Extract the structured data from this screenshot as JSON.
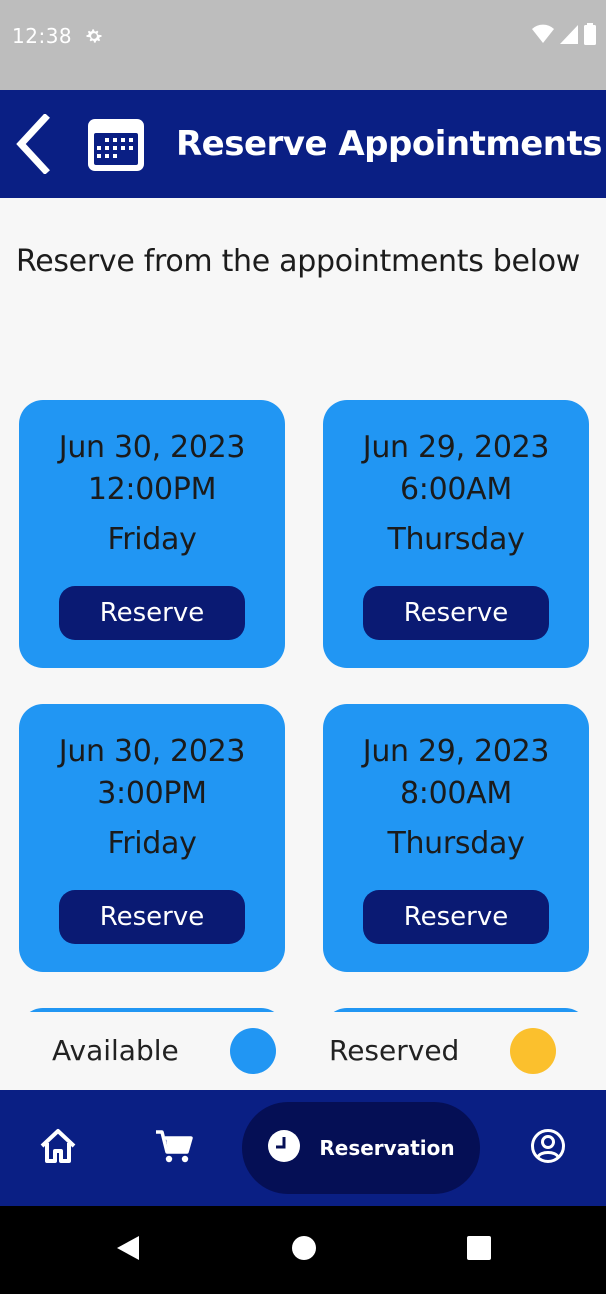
{
  "status_bar": {
    "time": "12:38"
  },
  "app_bar": {
    "title": "Reserve Appointments"
  },
  "instruction": "Reserve from the appointments below",
  "appointments": [
    {
      "date": "Jun 30, 2023",
      "time": "12:00PM",
      "day": "Friday",
      "button_label": "Reserve"
    },
    {
      "date": "Jun 29, 2023",
      "time": "6:00AM",
      "day": "Thursday",
      "button_label": "Reserve"
    },
    {
      "date": "Jun 30, 2023",
      "time": "3:00PM",
      "day": "Friday",
      "button_label": "Reserve"
    },
    {
      "date": "Jun 29, 2023",
      "time": "8:00AM",
      "day": "Thursday",
      "button_label": "Reserve"
    }
  ],
  "legend": {
    "available_label": "Available",
    "reserved_label": "Reserved",
    "available_color": "#2196f3",
    "reserved_color": "#fbc02d"
  },
  "bottom_nav": {
    "items": [
      {
        "icon": "home-icon"
      },
      {
        "icon": "cart-icon"
      },
      {
        "icon": "clock-icon",
        "label": "Reservation",
        "active": true
      },
      {
        "icon": "account-icon"
      }
    ]
  },
  "colors": {
    "primary": "#0a1f84",
    "card": "#2196f3",
    "button": "#0a1a73"
  }
}
